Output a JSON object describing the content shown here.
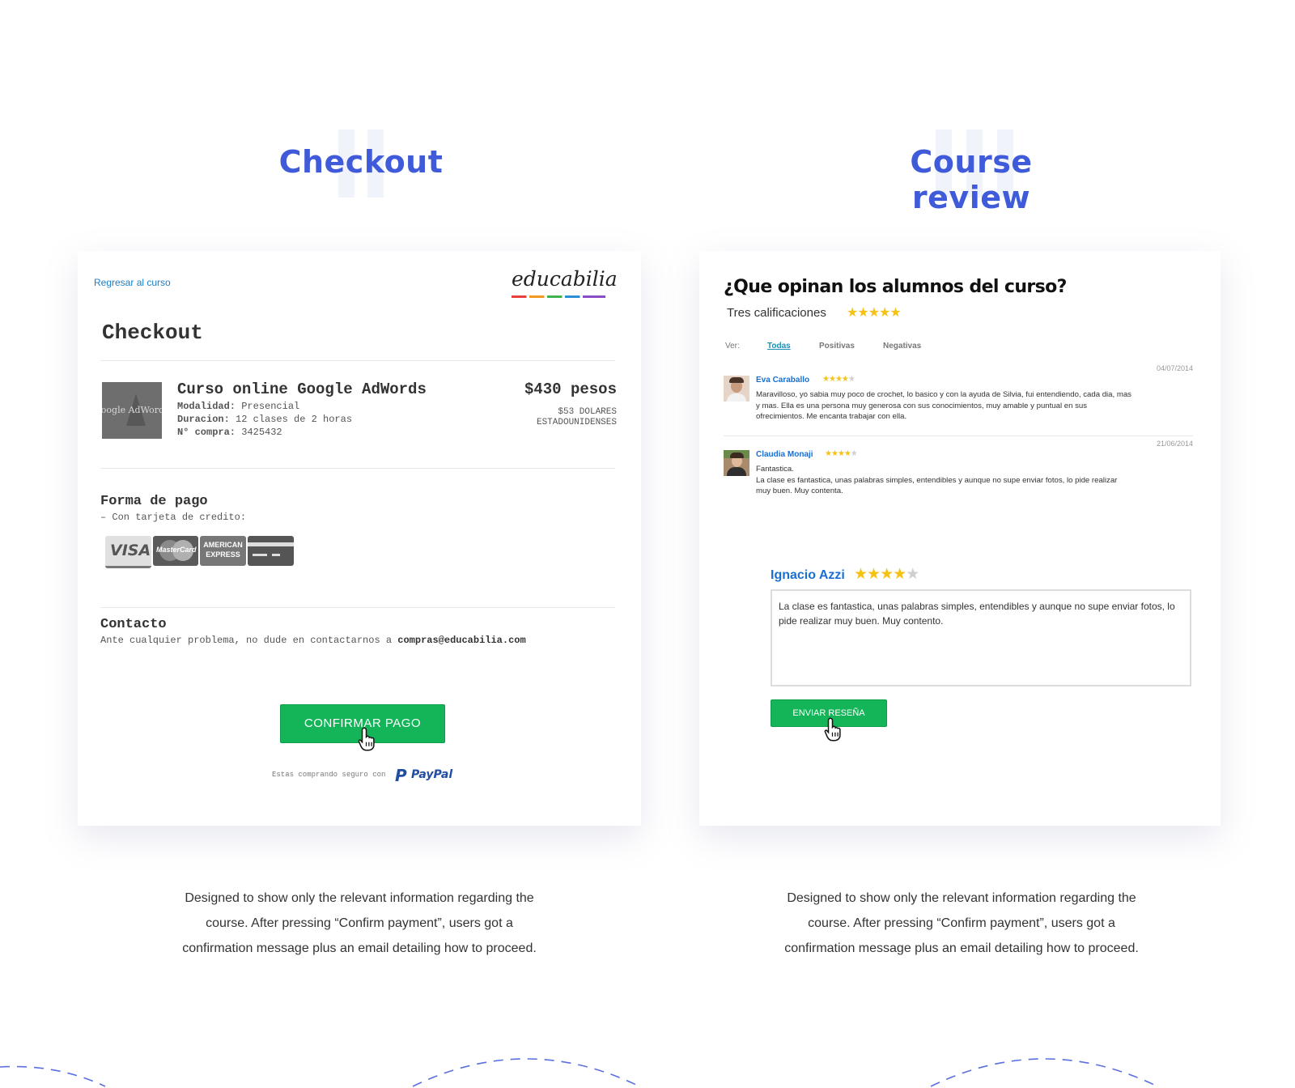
{
  "sections": {
    "checkout_heading": "Checkout",
    "review_heading": "Course review"
  },
  "checkout": {
    "back_link": "Regresar al curso",
    "logo_text": "educabilia",
    "title": "Checkout",
    "course": {
      "thumb_text": "Google AdWords",
      "name": "Curso online Google AdWords",
      "modalidad_label": "Modalidad:",
      "modalidad_value": "Presencial",
      "duracion_label": "Duracion:",
      "duracion_value": "12 clases de 2 horas",
      "compra_label": "N° compra:",
      "compra_value": "3425432",
      "price": "$430 pesos",
      "price_usd_line1": "$53 DOLARES",
      "price_usd_line2": "ESTADOUNIDENSES"
    },
    "payment": {
      "title": "Forma de pago",
      "subtitle": "– Con tarjeta de credito:",
      "cards": [
        "VISA",
        "MasterCard",
        "AMERICAN EXPRESS",
        "card"
      ]
    },
    "contact": {
      "title": "Contacto",
      "text": "Ante cualquier problema, no dude en contactarnos a",
      "email": "compras@educabilia.com"
    },
    "confirm_button": "CONFIRMAR PAGO",
    "secure_text": "Estas comprando seguro con",
    "paypal_text": "PayPal"
  },
  "review": {
    "title": "¿Que opinan los alumnos del curso?",
    "ratings_label": "Tres calificaciones",
    "overall_stars": 5,
    "filter_label": "Ver:",
    "filters": [
      "Todas",
      "Positivas",
      "Negativas"
    ],
    "active_filter": "Todas",
    "reviews": [
      {
        "date": "04/07/2014",
        "name": "Eva Caraballo",
        "stars": 4,
        "line1": "Maravilloso, yo sabia muy poco de crochet, lo basico y con la ayuda de Silvia, fui entendiendo, cada dia, mas",
        "line2": "y mas. Ella es una persona muy generosa con sus conocimientos, muy amable y puntual en sus",
        "line3": "ofrecimientos. Me encanta trabajar con ella."
      },
      {
        "date": "21/06/2014",
        "name": "Claudia Monaji",
        "stars": 4,
        "line1": "Fantastica.",
        "line2": "La clase es fantastica, unas palabras simples, entendibles y aunque no supe enviar fotos, lo pide realizar",
        "line3": "muy buen. Muy contenta."
      }
    ],
    "form": {
      "name": "Ignacio Azzi",
      "stars": 4,
      "text": "La clase es fantastica, unas palabras simples, entendibles y aunque no supe enviar fotos, lo pide realizar muy buen. Muy contento.",
      "button": "ENVIAR RESEÑA"
    }
  },
  "descriptions": {
    "left": "Designed to show only the relevant information regarding the course. After pressing “Confirm payment”, users got a confirmation message plus an email detailing how to proceed.",
    "right": "Designed to show only the relevant information regarding the course. After pressing “Confirm payment”, users got a confirmation message plus an email detailing how to proceed."
  },
  "colors": {
    "accent_blue": "#3f5bd9",
    "green_button": "#14b559",
    "link_blue": "#1a6fd1",
    "star_gold": "#f5c218"
  }
}
